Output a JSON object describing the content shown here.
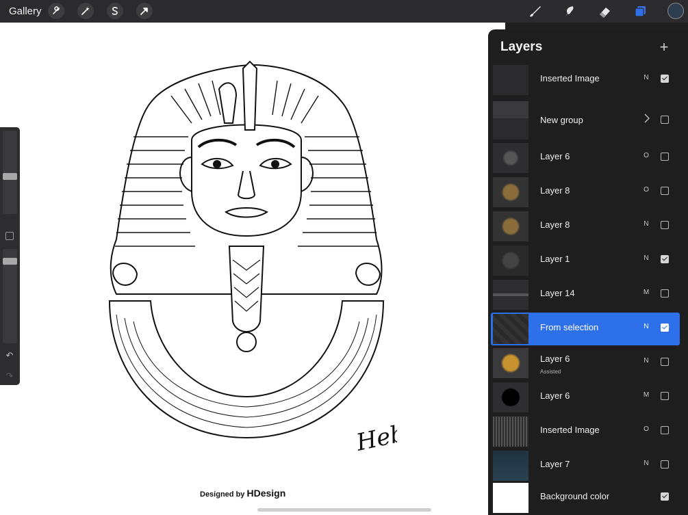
{
  "topbar": {
    "gallery_label": "Gallery",
    "left_tools": [
      {
        "name": "wrench-icon"
      },
      {
        "name": "magic-wand-icon"
      },
      {
        "name": "selection-s-icon"
      },
      {
        "name": "transform-arrow-icon"
      }
    ],
    "right_tools": [
      {
        "name": "brush-icon"
      },
      {
        "name": "smudge-icon"
      },
      {
        "name": "eraser-icon"
      },
      {
        "name": "layers-icon"
      }
    ],
    "current_color": "#2c3e50",
    "active_accent": "#2e6fea"
  },
  "layers_panel": {
    "title": "Layers",
    "add_symbol": "+",
    "layers": [
      {
        "name": "Inserted Image",
        "mode": "N",
        "visible": true
      },
      {
        "name": "New group",
        "mode": "",
        "visible": false,
        "group": true
      },
      {
        "name": "Layer 6",
        "mode": "O",
        "visible": false
      },
      {
        "name": "Layer 8",
        "mode": "O",
        "visible": false
      },
      {
        "name": "Layer 8",
        "mode": "N",
        "visible": false
      },
      {
        "name": "Layer 1",
        "mode": "N",
        "visible": true
      },
      {
        "name": "Layer 14",
        "mode": "M",
        "visible": false
      },
      {
        "name": "From selection",
        "mode": "N",
        "visible": true,
        "selected": true
      },
      {
        "name": "Layer 6",
        "subtitle": "Assisted",
        "mode": "N",
        "visible": false
      },
      {
        "name": "Layer 6",
        "mode": "M",
        "visible": false
      },
      {
        "name": "Inserted Image",
        "mode": "O",
        "visible": false
      },
      {
        "name": "Layer 7",
        "mode": "N",
        "visible": false
      },
      {
        "name": "Background color",
        "mode": "",
        "visible": true
      }
    ]
  },
  "sidebar": {
    "brush_size_level": 0.45,
    "opacity_level": 0.9
  },
  "canvas": {
    "signature": "Heba",
    "credit_prefix": "Designed by",
    "credit_brand": "HDesign"
  }
}
